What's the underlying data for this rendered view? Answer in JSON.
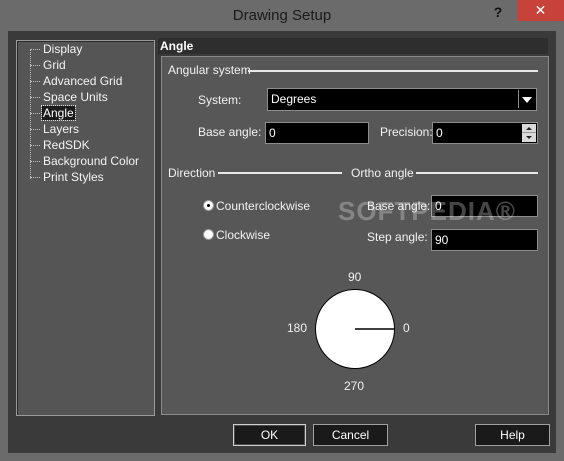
{
  "window": {
    "title": "Drawing Setup",
    "help": "?",
    "close": "✕"
  },
  "tree": {
    "items": [
      {
        "label": "Display"
      },
      {
        "label": "Grid"
      },
      {
        "label": "Advanced Grid"
      },
      {
        "label": "Space Units"
      },
      {
        "label": "Angle",
        "selected": true
      },
      {
        "label": "Layers"
      },
      {
        "label": "RedSDK"
      },
      {
        "label": "Background Color"
      },
      {
        "label": "Print Styles"
      }
    ]
  },
  "section": {
    "title": "Angle",
    "angular_system": {
      "label": "Angular system",
      "system_label": "System:",
      "system_value": "Degrees",
      "base_angle_label": "Base angle:",
      "base_angle_value": "0",
      "precision_label": "Precision:",
      "precision_value": "0"
    },
    "direction": {
      "label": "Direction",
      "ccw_label": "Counterclockwise",
      "cw_label": "Clockwise",
      "selected": "Counterclockwise"
    },
    "ortho": {
      "label": "Ortho angle",
      "base_angle_label": "Base angle:",
      "base_angle_value": "0",
      "step_angle_label": "Step angle:",
      "step_angle_value": "90"
    },
    "dial": {
      "top": "90",
      "left": "180",
      "right": "0",
      "bottom": "270",
      "pointer_angle_deg": 0
    }
  },
  "buttons": {
    "ok": "OK",
    "cancel": "Cancel",
    "help": "Help"
  },
  "watermark": "SOFTPEDIA®"
}
